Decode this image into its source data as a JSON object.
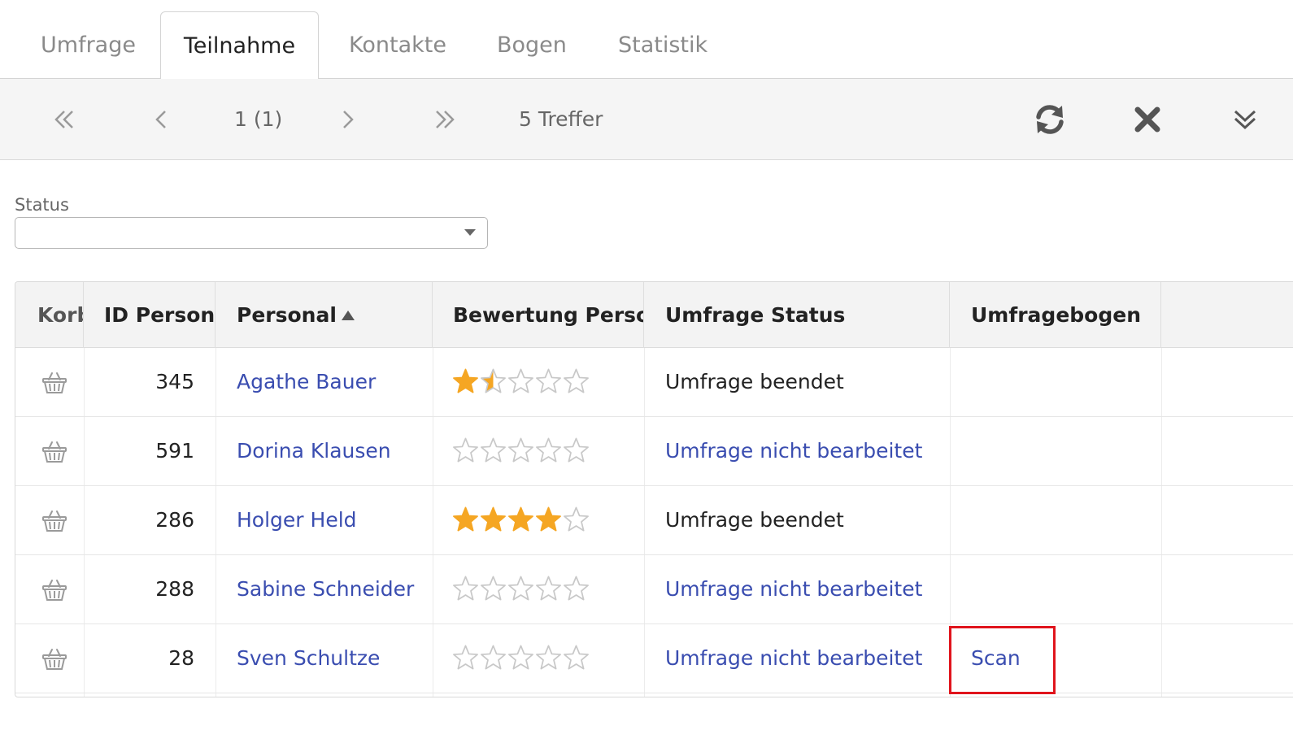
{
  "tabs": [
    {
      "label": "Umfrage"
    },
    {
      "label": "Teilnahme"
    },
    {
      "label": "Kontakte"
    },
    {
      "label": "Bogen"
    },
    {
      "label": "Statistik"
    }
  ],
  "active_tab": "Teilnahme",
  "toolbar": {
    "page_info": "1 (1)",
    "hits": "5 Treffer",
    "icons": [
      "first-page-icon",
      "prev-page-icon",
      "next-page-icon",
      "last-page-icon",
      "refresh-icon",
      "close-icon",
      "expand-down-icon"
    ]
  },
  "filter": {
    "label": "Status",
    "value": ""
  },
  "table": {
    "headers": {
      "korb": "Korb",
      "id": "ID Persona",
      "personal": "Personal",
      "bewertung": "Bewertung Persona",
      "status": "Umfrage Status",
      "bogen": "Umfragebogen"
    },
    "sort": {
      "column": "Personal",
      "direction": "ascending"
    },
    "rows": [
      {
        "id": "345",
        "name": "Agathe Bauer",
        "rating": 1.5,
        "status": "Umfrage beendet",
        "status_link": false,
        "bogen": ""
      },
      {
        "id": "591",
        "name": "Dorina Klausen",
        "rating": 0,
        "status": "Umfrage nicht bearbeitet",
        "status_link": true,
        "bogen": ""
      },
      {
        "id": "286",
        "name": "Holger Held",
        "rating": 4,
        "status": "Umfrage beendet",
        "status_link": false,
        "bogen": ""
      },
      {
        "id": "288",
        "name": "Sabine Schneider",
        "rating": 0,
        "status": "Umfrage nicht bearbeitet",
        "status_link": true,
        "bogen": ""
      },
      {
        "id": "28",
        "name": "Sven Schultze",
        "rating": 0,
        "status": "Umfrage nicht bearbeitet",
        "status_link": true,
        "bogen": "Scan"
      }
    ],
    "rating_max": 5
  },
  "colors": {
    "link": "#3a4db0",
    "star_filled": "#f5a623",
    "star_empty": "#c8c8c8",
    "highlight": "#e0141c"
  }
}
